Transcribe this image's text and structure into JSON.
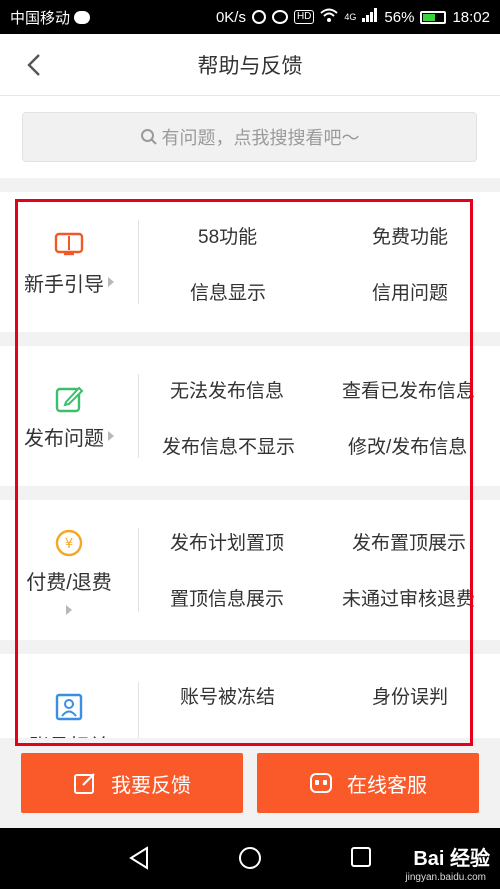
{
  "status_bar": {
    "carrier": "中国移动",
    "speed": "0K/s",
    "network": "4G",
    "battery": "56%",
    "time": "18:02"
  },
  "header": {
    "title": "帮助与反馈"
  },
  "search": {
    "placeholder": "有问题，点我搜搜看吧～"
  },
  "categories": [
    {
      "label": "新手引导",
      "icon": "book-icon",
      "color": "#f05a28",
      "links": [
        "58功能",
        "免费功能",
        "信息显示",
        "信用问题"
      ]
    },
    {
      "label": "发布问题",
      "icon": "edit-icon",
      "color": "#3cbf6a",
      "links": [
        "无法发布信息",
        "查看已发布信息",
        "发布信息不显示",
        "修改/发布信息"
      ]
    },
    {
      "label": "付费/退费",
      "icon": "yen-icon",
      "color": "#f5a623",
      "links": [
        "发布计划置顶",
        "发布置顶展示",
        "置顶信息展示",
        "未通过审核退费"
      ]
    },
    {
      "label": "账号相关",
      "icon": "id-card-icon",
      "color": "#3a8ee6",
      "links": [
        "账号被冻结",
        "身份误判"
      ]
    }
  ],
  "buttons": {
    "feedback": "我要反馈",
    "service": "在线客服"
  },
  "watermark": {
    "logo": "Bai 经验",
    "url": "jingyan.baidu.com"
  },
  "colors": {
    "accent": "#fa5a2a",
    "highlight_box": "#e6001a"
  }
}
